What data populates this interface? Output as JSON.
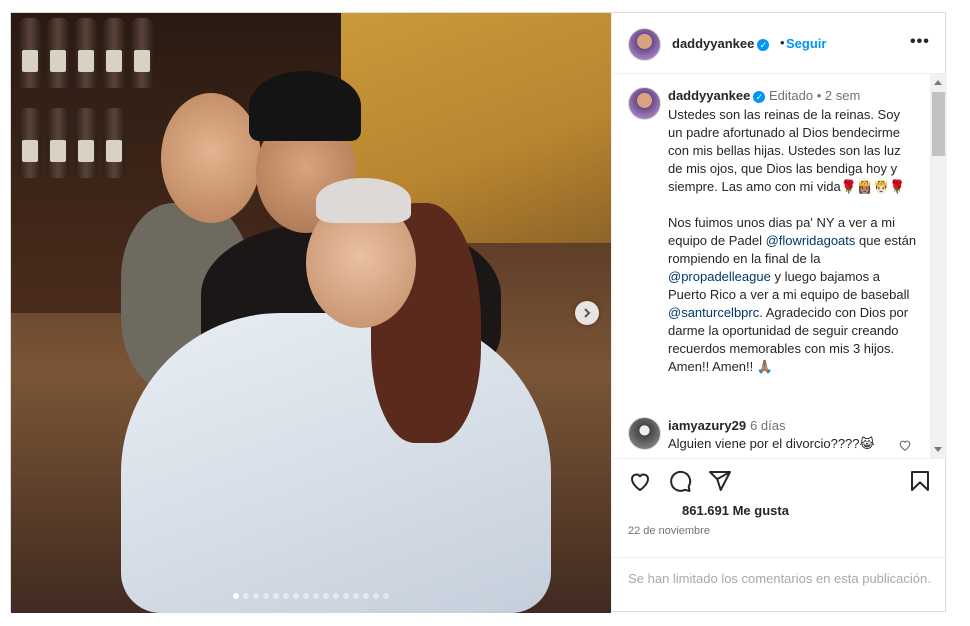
{
  "post": {
    "username": "daddyyankee",
    "follow_label": "Seguir",
    "more_label": "•••",
    "header_separator": "•"
  },
  "caption": {
    "username": "daddyyankee",
    "edited": "Editado",
    "separator": "•",
    "time": "2 sem",
    "paragraph1": "Ustedes son las reinas de la reinas. Soy un padre afortunado al Dios bendecirme con mis bellas hijas. Ustedes son las luz de mis ojos, que Dios las bendiga hoy y siempre. Las amo con mi vida🌹👸🏽🤴🏻🌹",
    "p2_a": "Nos fuimos unos dias pa' NY a ver a mi equipo de Padel ",
    "p2_mention1": "@flowridagoats",
    "p2_b": " que están rompiendo en la final de la ",
    "p2_mention2": "@propadelleague",
    "p2_c": " y luego bajamos a Puerto Rico a ver a mi equipo de baseball ",
    "p2_mention3": "@santurcelbprc",
    "p2_d": ". Agradecido con Dios por darme la oportunidad de seguir creando recuerdos memorables con mis 3 hijos. Amen!! Amen!! 🙏🏽"
  },
  "comment": {
    "username": "iamyazury29",
    "time": "6 días",
    "text": "Alguien viene por el divorcio????😹"
  },
  "likes": "861.691 Me gusta",
  "date": "22 de noviembre",
  "comments_limited": "Se han limitado los comentarios en esta publicación.",
  "carousel": {
    "total": 16,
    "active_index": 0
  },
  "colors": {
    "accent": "#0095f6",
    "mention": "#00376b",
    "muted": "#737373"
  },
  "icons": [
    "verified-icon",
    "more-icon",
    "next-arrow-icon",
    "heart-icon",
    "comment-icon",
    "share-icon",
    "bookmark-icon"
  ]
}
